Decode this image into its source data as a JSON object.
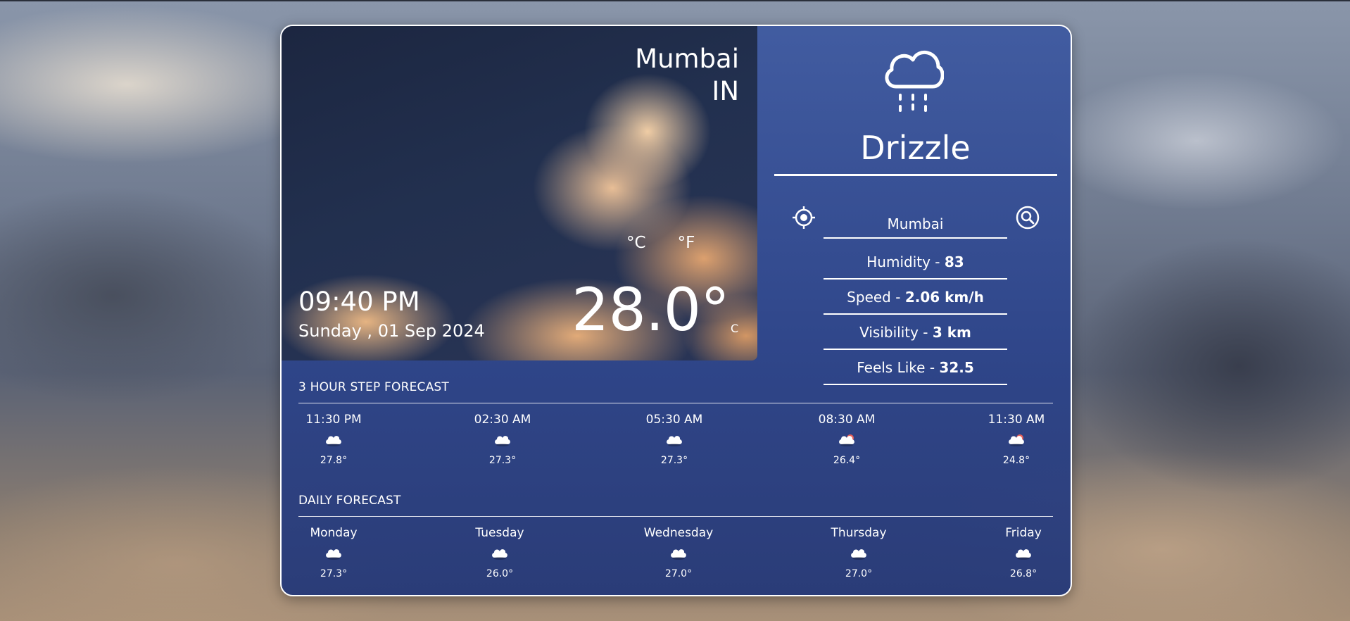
{
  "location": {
    "city": "Mumbai",
    "country": "IN"
  },
  "units": {
    "celsius": "°C",
    "fahrenheit": "°F"
  },
  "current": {
    "time": "09:40 PM",
    "date": "Sunday , 01 Sep 2024",
    "temperature": "28.0°",
    "temp_unit": "C",
    "condition": "Drizzle",
    "condition_icon": "cloud-drizzle-icon"
  },
  "search": {
    "value": "Mumbai"
  },
  "stats": [
    {
      "label": "Humidity - ",
      "value": "83"
    },
    {
      "label": "Speed - ",
      "value": "2.06 km/h"
    },
    {
      "label": "Visibility - ",
      "value": "3 km"
    },
    {
      "label": "Feels Like - ",
      "value": "32.5"
    }
  ],
  "hourly": {
    "title": "3 HOUR STEP FORECAST",
    "items": [
      {
        "time": "11:30 PM",
        "icon": "cloud-icon",
        "temp": "27.8°"
      },
      {
        "time": "02:30 AM",
        "icon": "cloud-icon",
        "temp": "27.3°"
      },
      {
        "time": "05:30 AM",
        "icon": "cloud-icon",
        "temp": "27.3°"
      },
      {
        "time": "08:30 AM",
        "icon": "cloud-rain-icon",
        "temp": "26.4°"
      },
      {
        "time": "11:30 AM",
        "icon": "cloud-rain-icon",
        "temp": "24.8°"
      }
    ]
  },
  "daily": {
    "title": "DAILY FORECAST",
    "items": [
      {
        "day": "Monday",
        "icon": "cloud-icon",
        "temp": "27.3°"
      },
      {
        "day": "Tuesday",
        "icon": "cloud-icon",
        "temp": "26.0°"
      },
      {
        "day": "Wednesday",
        "icon": "cloud-icon",
        "temp": "27.0°"
      },
      {
        "day": "Thursday",
        "icon": "cloud-icon",
        "temp": "27.0°"
      },
      {
        "day": "Friday",
        "icon": "cloud-icon",
        "temp": "26.8°"
      }
    ]
  },
  "colors": {
    "card_border": "#ffffff",
    "panel_blue": "#2c448c",
    "text": "#ffffff",
    "rain_accent": "#e8605a"
  }
}
